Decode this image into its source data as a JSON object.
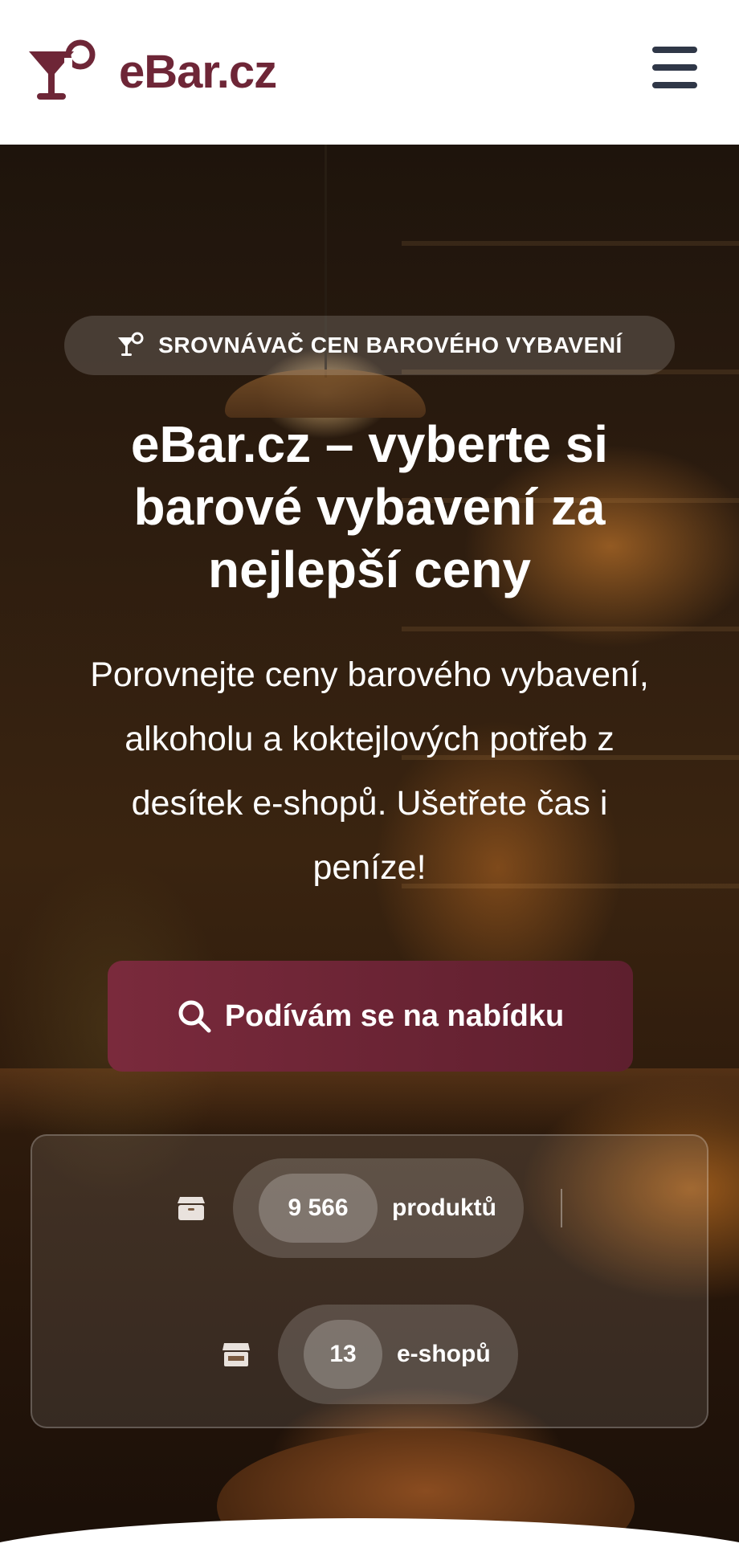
{
  "header": {
    "brand": "eBar.cz",
    "logo_icon": "cocktail-glass-icon",
    "menu_icon": "hamburger-menu-icon"
  },
  "hero": {
    "badge": "SROVNÁVAČ CEN BAROVÉHO VYBAVENÍ",
    "badge_icon": "cocktail-glass-icon",
    "title_lines": [
      "eBar.cz – vyberte si",
      "barové vybavení za",
      "nejlepší ceny"
    ],
    "subtitle_lines": [
      "Porovnejte ceny barového vybavení,",
      "alkoholu a koktejlových potřeb z",
      "desítek e-shopů. Ušetřete čas i",
      "peníze!"
    ],
    "cta_label": "Podívám se na nabídku",
    "cta_icon": "search-icon"
  },
  "stats": {
    "products": {
      "count": "9 566",
      "label": "produktů",
      "icon": "box-icon"
    },
    "shops": {
      "count": "13",
      "label": "e-shopů",
      "icon": "store-icon"
    }
  },
  "colors": {
    "brand": "#6e2637",
    "cta_start": "#7a2a3c",
    "cta_end": "#5e1f2e",
    "menu": "#2f3747"
  }
}
